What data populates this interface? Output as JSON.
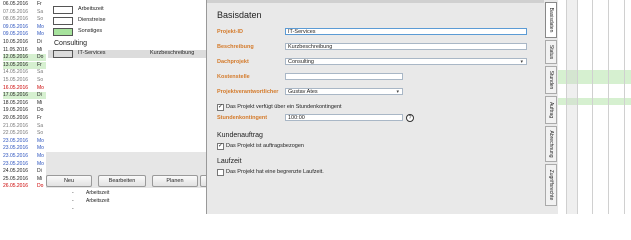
{
  "date_list": [
    {
      "date": "06.05.2016",
      "wd": "Fr",
      "color": "#222222",
      "bg": ""
    },
    {
      "date": "07.05.2016",
      "wd": "Sa",
      "color": "#777777",
      "bg": ""
    },
    {
      "date": "08.05.2016",
      "wd": "So",
      "color": "#777777",
      "bg": ""
    },
    {
      "date": "09.05.2016",
      "wd": "Mo",
      "color": "#2a52be",
      "bg": ""
    },
    {
      "date": "09.05.2016",
      "wd": "Mo",
      "color": "#2a52be",
      "bg": ""
    },
    {
      "date": "10.05.2016",
      "wd": "Di",
      "color": "#222222",
      "bg": ""
    },
    {
      "date": "11.05.2016",
      "wd": "Mi",
      "color": "#222222",
      "bg": ""
    },
    {
      "date": "12.05.2016",
      "wd": "Do",
      "color": "#222222",
      "bg": "#d6f0d0"
    },
    {
      "date": "13.05.2016",
      "wd": "Fr",
      "color": "#222222",
      "bg": "#d6f0d0"
    },
    {
      "date": "14.05.2016",
      "wd": "Sa",
      "color": "#777777",
      "bg": ""
    },
    {
      "date": "15.05.2016",
      "wd": "So",
      "color": "#777777",
      "bg": ""
    },
    {
      "date": "16.05.2016",
      "wd": "Mo",
      "color": "#cc0000",
      "bg": ""
    },
    {
      "date": "17.05.2016",
      "wd": "Di",
      "color": "#222222",
      "bg": "#d6f0d0"
    },
    {
      "date": "18.05.2016",
      "wd": "Mi",
      "color": "#222222",
      "bg": ""
    },
    {
      "date": "19.05.2016",
      "wd": "Do",
      "color": "#222222",
      "bg": ""
    },
    {
      "date": "20.05.2016",
      "wd": "Fr",
      "color": "#222222",
      "bg": ""
    },
    {
      "date": "21.05.2016",
      "wd": "Sa",
      "color": "#777777",
      "bg": ""
    },
    {
      "date": "22.05.2016",
      "wd": "So",
      "color": "#777777",
      "bg": ""
    },
    {
      "date": "23.05.2016",
      "wd": "Mo",
      "color": "#2a52be",
      "bg": ""
    },
    {
      "date": "23.05.2016",
      "wd": "Mo",
      "color": "#2a52be",
      "bg": ""
    },
    {
      "date": "23.05.2016",
      "wd": "Mo",
      "color": "#2a52be",
      "bg": ""
    },
    {
      "date": "23.05.2016",
      "wd": "Mo",
      "color": "#2a52be",
      "bg": ""
    },
    {
      "date": "24.05.2016",
      "wd": "Di",
      "color": "#222222",
      "bg": ""
    },
    {
      "date": "25.05.2016",
      "wd": "Mi",
      "color": "#222222",
      "bg": ""
    },
    {
      "date": "26.05.2016",
      "wd": "Do",
      "color": "#cc0000",
      "bg": ""
    }
  ],
  "tree": {
    "items": [
      {
        "label": "Arbeitszeit",
        "color": "#ffffff"
      },
      {
        "label": "Dienstreise",
        "color": "#ffffff"
      },
      {
        "label": "Sonstiges",
        "color": "#a7e39d"
      }
    ],
    "group": "Consulting",
    "project_row": {
      "name": "IT-Services",
      "description": "Kurzbeschreibung",
      "color": "#ffffff"
    }
  },
  "buttons": {
    "new": "Neu",
    "edit": "Bearbeiten",
    "plan": "Planen"
  },
  "bottom_list": [
    {
      "dash": "-",
      "label": "Arbeitszeit"
    },
    {
      "dash": "-",
      "label": "Arbeitszeit"
    },
    {
      "dash": "-",
      "label": ""
    }
  ],
  "dialog": {
    "section_basisdaten": "Basisdaten",
    "projekt_id": {
      "label": "Projekt-ID",
      "value": "IT-Services"
    },
    "beschreibung": {
      "label": "Beschreibung",
      "value": "Kurzbeschreibung"
    },
    "dachprojekt": {
      "label": "Dachprojekt",
      "value": "Consulting"
    },
    "kostenstelle": {
      "label": "Kostenstelle",
      "value": ""
    },
    "verantwortlicher": {
      "label": "Projektverantwortlicher",
      "value": "Gustav Ates"
    },
    "stundenkontingent_cb": {
      "label": "Das Projekt verfügt über ein Stundenkontingent",
      "checked": true
    },
    "stundenkontingent": {
      "label": "Stundenkontingent",
      "value": "100:00"
    },
    "section_kundenauftrag": "Kundenauftrag",
    "auftragsbezogen_cb": {
      "label": "Das Projekt ist auftragsbezogen",
      "checked": true
    },
    "section_laufzeit": "Laufzeit",
    "laufzeit_cb": {
      "label": "Das Projekt hat eine begrenzte Laufzeit.",
      "checked": false
    }
  },
  "tabs": [
    "Basisdaten",
    "Status",
    "Stunden",
    "Auftrag",
    "Abrechnung",
    "Zugriffsrechte"
  ],
  "colors": {
    "accent_label": "#d47a2a",
    "green_row": "#d6f0d0",
    "focus_border": "#5b9bd5"
  }
}
